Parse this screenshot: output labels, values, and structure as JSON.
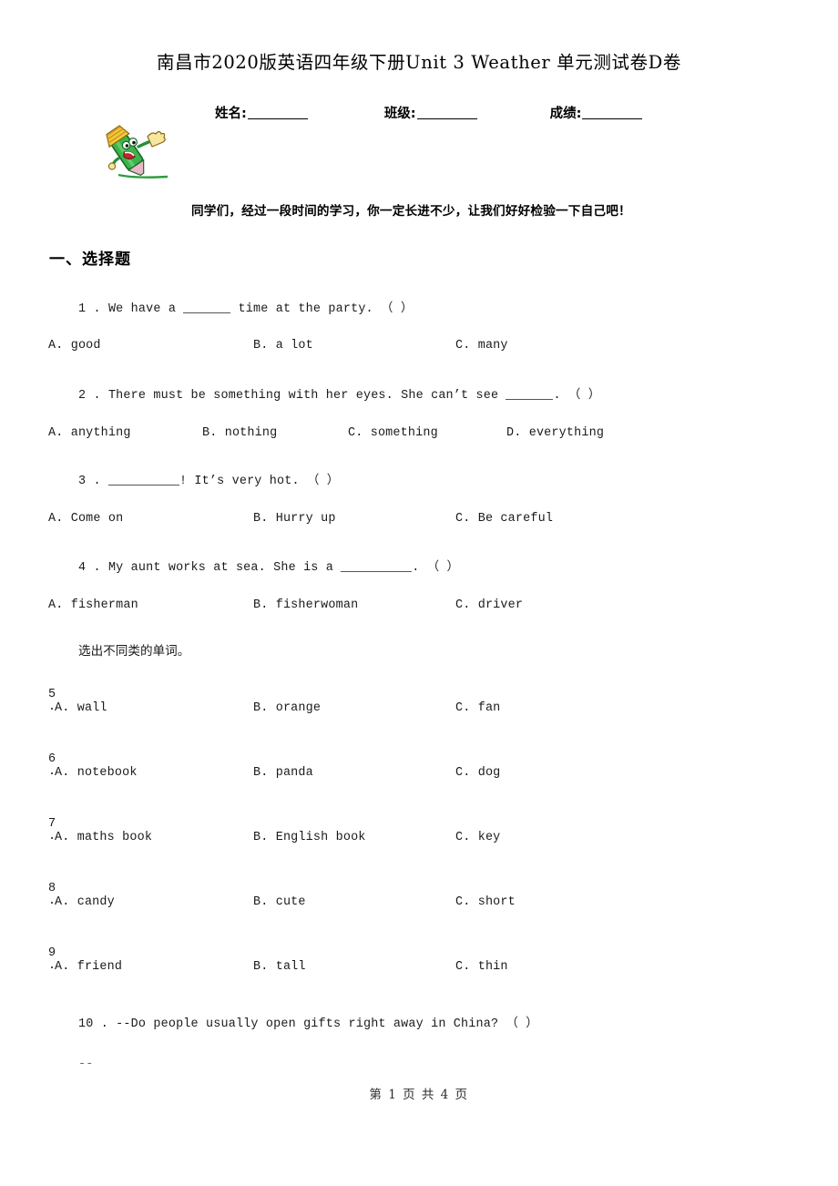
{
  "document": {
    "title": "南昌市2020版英语四年级下册Unit 3 Weather 单元测试卷D卷",
    "greeting": "同学们，经过一段时间的学习，你一定长进不少，让我们好好检验一下自己吧！",
    "footer": "第 1 页 共 4 页"
  },
  "identity": {
    "name_label": "姓名:",
    "class_label": "班级:",
    "score_label": "成绩:"
  },
  "mascot": {
    "alt": "cartoon-green-pencil-character-waving",
    "colors": {
      "body": "#3cb44b",
      "body_dark": "#1f7a2e",
      "hat": "#f2d23a",
      "hat_stripe": "#d99a2b",
      "hand": "#f7e6a0",
      "tip": "#e7b6c6",
      "line": "#2e9c3e"
    }
  },
  "section": {
    "heading": "一、选择题"
  },
  "sub_instructions": {
    "word_class": "选出不同类的单词。"
  },
  "questions": [
    {
      "number": "1",
      "stem_pre": "1 . We have a ",
      "stem_mid": " time at the party. （   ）",
      "blank": "short",
      "options": [
        {
          "key": "A",
          "text": "A. good"
        },
        {
          "key": "B",
          "text": "B. a lot"
        },
        {
          "key": "C",
          "text": "C. many"
        }
      ]
    },
    {
      "number": "2",
      "stem_pre": "2 . There must be something with her eyes. She can’t see ",
      "stem_mid": ". （   ）",
      "blank": "short",
      "options": [
        {
          "key": "A",
          "text": "A. anything"
        },
        {
          "key": "B",
          "text": "B. nothing"
        },
        {
          "key": "C",
          "text": "C. something"
        },
        {
          "key": "D",
          "text": "D. everything"
        }
      ]
    },
    {
      "number": "3",
      "stem_pre": "3 . ",
      "stem_mid": "! It’s very hot. （   ）",
      "blank": "medium",
      "options": [
        {
          "key": "A",
          "text": "A. Come on"
        },
        {
          "key": "B",
          "text": "B. Hurry up"
        },
        {
          "key": "C",
          "text": "C. Be careful"
        }
      ]
    },
    {
      "number": "4",
      "stem_pre": "4 . My aunt works at sea. She is a ",
      "stem_mid": ". （   ）",
      "blank": "medium",
      "options": [
        {
          "key": "A",
          "text": "A. fisherman"
        },
        {
          "key": "B",
          "text": "B. fisherwoman"
        },
        {
          "key": "C",
          "text": "C. driver"
        }
      ]
    },
    {
      "number": "5",
      "dot": ".",
      "options": [
        {
          "key": "A",
          "text": "A. wall"
        },
        {
          "key": "B",
          "text": "B. orange"
        },
        {
          "key": "C",
          "text": "C. fan"
        }
      ]
    },
    {
      "number": "6",
      "dot": ".",
      "options": [
        {
          "key": "A",
          "text": "A. notebook"
        },
        {
          "key": "B",
          "text": "B. panda"
        },
        {
          "key": "C",
          "text": "C. dog"
        }
      ]
    },
    {
      "number": "7",
      "dot": ".",
      "options": [
        {
          "key": "A",
          "text": "A. maths book"
        },
        {
          "key": "B",
          "text": "B. English book"
        },
        {
          "key": "C",
          "text": "C. key"
        }
      ]
    },
    {
      "number": "8",
      "dot": ".",
      "options": [
        {
          "key": "A",
          "text": "A. candy"
        },
        {
          "key": "B",
          "text": "B. cute"
        },
        {
          "key": "C",
          "text": "C. short"
        }
      ]
    },
    {
      "number": "9",
      "dot": ".",
      "options": [
        {
          "key": "A",
          "text": "A. friend"
        },
        {
          "key": "B",
          "text": "B. tall"
        },
        {
          "key": "C",
          "text": "C. thin"
        }
      ]
    },
    {
      "number": "10",
      "stem_full": "10 . --Do people usually open gifts right away in China? （   ）",
      "trailing": "--"
    }
  ]
}
